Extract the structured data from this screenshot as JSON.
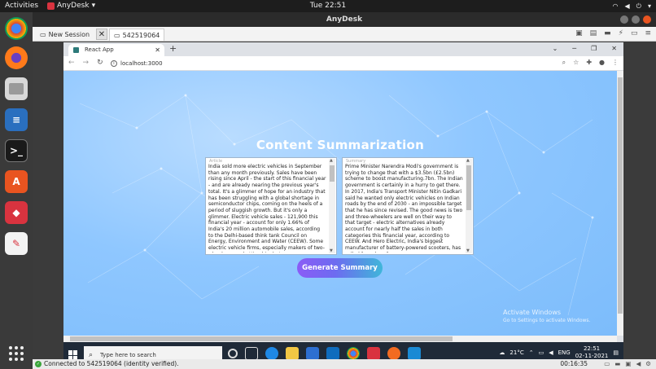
{
  "topbar": {
    "activities": "Activities",
    "app_name": "AnyDesk",
    "clock": "Tue 22:51"
  },
  "anydesk": {
    "title": "AnyDesk",
    "tab_new_session": "New Session",
    "tab_remote_id": "542519064",
    "status_text": "Connected to 542519064 (identity verified).",
    "session_timer": "00:16:35"
  },
  "browser": {
    "tab_title": "React App",
    "new_tab_symbol": "+",
    "url": "localhost:3000"
  },
  "page": {
    "title": "Content Summarization",
    "article_label": "Article",
    "article_text": "India sold more electric vehicles in September than any month previously. Sales have been rising since April - the start of this financial year - and are already nearing the previous year's total. It's a glimmer of hope for an industry that has been struggling with a global shortage in semiconductor chips, coming on the heels of a period of sluggish growth. But it's only a glimmer. Electric vehicle sales - 121,900 this financial year - account for only 1.66% of India's 20 million automobile sales, according to the Delhi-based think tank Council on Energy, Environment and Water (CEEW). Some electric vehicle firms, especially makers of two-wheelers, are betting big, but",
    "summary_label": "Summary",
    "summary_text": " Prime Minister Narendra Modi's government is trying to change that with a $3.5bn (£2.5bn) scheme to boost manufacturing.7bn. The Indian government is certainly in a hurry to get there. In 2017, India's Transport Minister Nitin Gadkari said he wanted only electric vehicles on Indian roads by the end of 2030 - an impossible target that he has since revised. The good news is two and three-wheelers are well on their way to that target - electric alternatives already account for nearly half the sales in both categories this financial year, according to CEEW. And Hero Electric, India's biggest manufacturer of battery-powered scooters, has called for sales of",
    "generate_button": "Generate Summary",
    "watermark_title": "Activate Windows",
    "watermark_sub": "Go to Settings to activate Windows."
  },
  "taskbar": {
    "search_placeholder": "Type here to search",
    "weather": "21°C",
    "language": "ENG",
    "time": "22:51",
    "date": "02-11-2021"
  },
  "colors": {
    "accent_gradient_start": "#8b5cf6",
    "accent_gradient_end": "#3fb6d9",
    "page_bg": "#8fc7ff"
  }
}
